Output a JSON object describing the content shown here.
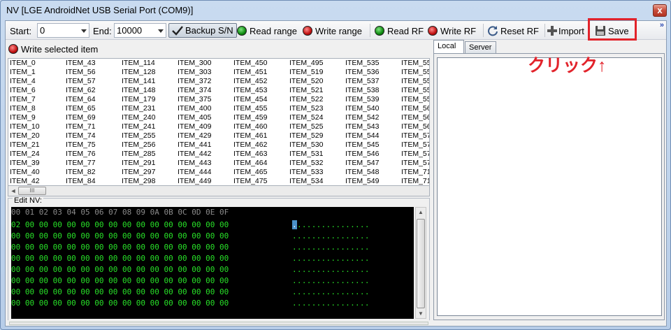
{
  "window": {
    "title": "NV  [LGE AndroidNet USB Serial Port (COM9)]",
    "close_glyph": "x"
  },
  "toolbar": {
    "start_label": "Start:",
    "start_value": "0",
    "end_label": "End:",
    "end_value": "10000",
    "backup_label": "Backup S/N",
    "read_range_label": "Read range",
    "write_range_label": "Write range",
    "read_rf_label": "Read RF",
    "write_rf_label": "Write RF",
    "reset_rf_label": "Reset RF",
    "import_label": "Import",
    "save_label": "Save",
    "overflow_glyph": "»"
  },
  "annotation": {
    "text": "クリック↑",
    "color": "#e2232b"
  },
  "write_selected_label": "Write selected item",
  "items": {
    "columns": [
      [
        "ITEM_0",
        "ITEM_1",
        "ITEM_4",
        "ITEM_6",
        "ITEM_7",
        "ITEM_8",
        "ITEM_9",
        "ITEM_10",
        "ITEM_20",
        "ITEM_21",
        "ITEM_24",
        "ITEM_39",
        "ITEM_40",
        "ITEM_42"
      ],
      [
        "ITEM_43",
        "ITEM_56",
        "ITEM_57",
        "ITEM_62",
        "ITEM_64",
        "ITEM_65",
        "ITEM_69",
        "ITEM_71",
        "ITEM_74",
        "ITEM_75",
        "ITEM_76",
        "ITEM_77",
        "ITEM_82",
        "ITEM_84"
      ],
      [
        "ITEM_114",
        "ITEM_128",
        "ITEM_141",
        "ITEM_148",
        "ITEM_179",
        "ITEM_231",
        "ITEM_240",
        "ITEM_241",
        "ITEM_255",
        "ITEM_256",
        "ITEM_285",
        "ITEM_291",
        "ITEM_297",
        "ITEM_298"
      ],
      [
        "ITEM_300",
        "ITEM_303",
        "ITEM_372",
        "ITEM_374",
        "ITEM_375",
        "ITEM_400",
        "ITEM_405",
        "ITEM_409",
        "ITEM_429",
        "ITEM_441",
        "ITEM_442",
        "ITEM_443",
        "ITEM_444",
        "ITEM_449"
      ],
      [
        "ITEM_450",
        "ITEM_451",
        "ITEM_452",
        "ITEM_453",
        "ITEM_454",
        "ITEM_455",
        "ITEM_459",
        "ITEM_460",
        "ITEM_461",
        "ITEM_462",
        "ITEM_463",
        "ITEM_464",
        "ITEM_465",
        "ITEM_475"
      ],
      [
        "ITEM_495",
        "ITEM_519",
        "ITEM_520",
        "ITEM_521",
        "ITEM_522",
        "ITEM_523",
        "ITEM_524",
        "ITEM_525",
        "ITEM_529",
        "ITEM_530",
        "ITEM_531",
        "ITEM_532",
        "ITEM_533",
        "ITEM_534"
      ],
      [
        "ITEM_535",
        "ITEM_536",
        "ITEM_537",
        "ITEM_538",
        "ITEM_539",
        "ITEM_540",
        "ITEM_542",
        "ITEM_543",
        "ITEM_544",
        "ITEM_545",
        "ITEM_546",
        "ITEM_547",
        "ITEM_548",
        "ITEM_549"
      ],
      [
        "ITEM_55",
        "ITEM_55",
        "ITEM_55",
        "ITEM_55",
        "ITEM_55",
        "ITEM_56",
        "ITEM_56",
        "ITEM_56",
        "ITEM_57",
        "ITEM_57",
        "ITEM_57",
        "ITEM_57",
        "ITEM_71",
        "ITEM_71"
      ]
    ],
    "scroll_thumb_glyph": "III",
    "scroll_left_glyph": "◄"
  },
  "edit": {
    "label": "Edit NV:",
    "header": "00 01 02 03 04 05 06 07 08 09 0A 0B 0C 0D 0E 0F",
    "hex_rows": [
      "02 00 00 00 00 00 00 00 00 00 00 00 00 00 00 00",
      "00 00 00 00 00 00 00 00 00 00 00 00 00 00 00 00",
      "00 00 00 00 00 00 00 00 00 00 00 00 00 00 00 00",
      "00 00 00 00 00 00 00 00 00 00 00 00 00 00 00 00",
      "00 00 00 00 00 00 00 00 00 00 00 00 00 00 00 00",
      "00 00 00 00 00 00 00 00 00 00 00 00 00 00 00 00",
      "00 00 00 00 00 00 00 00 00 00 00 00 00 00 00 00",
      "00 00 00 00 00 00 00 00 00 00 00 00 00 00 00 00"
    ],
    "ascii_first_char": ".",
    "ascii_rows": [
      "...............",
      "................",
      "................",
      "................",
      "................",
      "................",
      "................",
      "................"
    ]
  },
  "tabs": [
    {
      "label": "Local",
      "active": true
    },
    {
      "label": "Server",
      "active": false
    }
  ]
}
